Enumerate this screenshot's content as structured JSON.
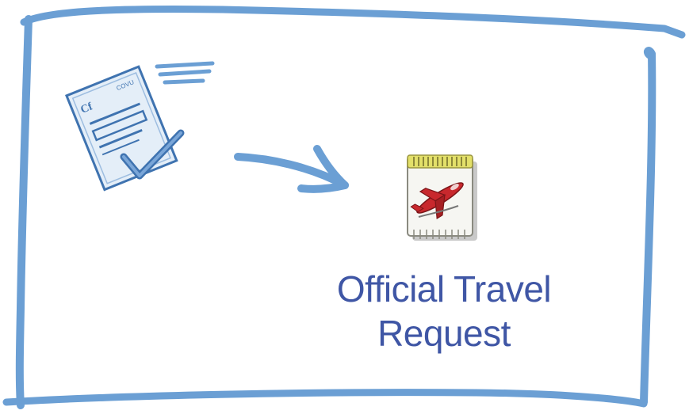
{
  "doc_icon": {
    "corner_text": "COVU"
  },
  "node": {
    "line1": "Official Travel",
    "line2": "Request"
  },
  "colors": {
    "frame": "#6b9fd4",
    "text": "#3f56a5",
    "doc_fill": "#e4eef8",
    "doc_stroke": "#3f73b0",
    "plane_red": "#c8282d"
  }
}
